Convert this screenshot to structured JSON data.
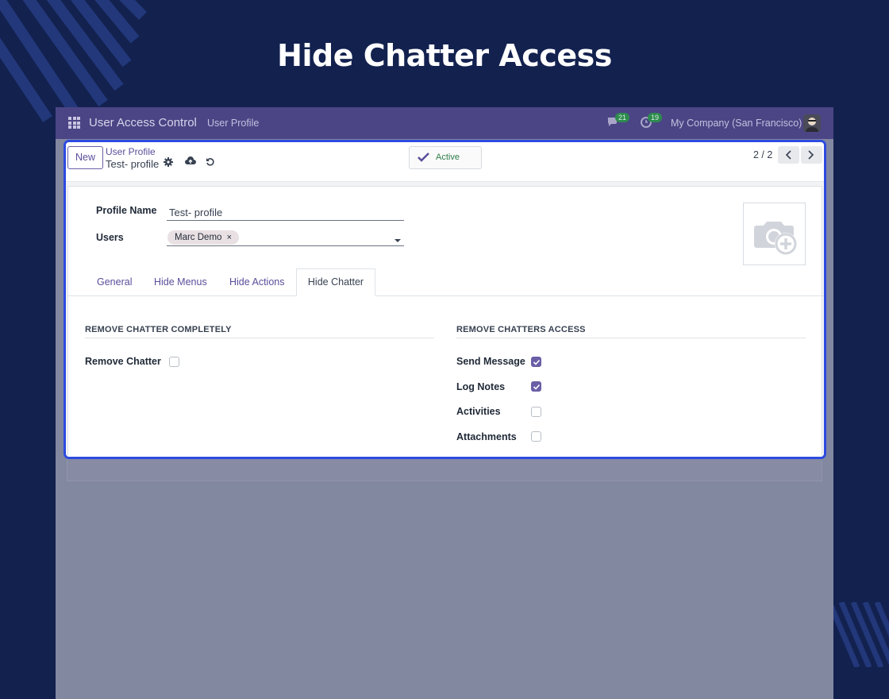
{
  "banner": {
    "title": "Hide Chatter Access"
  },
  "navbar": {
    "app_name": "User Access Control",
    "menu_item": "User Profile",
    "messages_count": "21",
    "activities_count": "19",
    "company": "My Company (San Francisco)"
  },
  "control_panel": {
    "new_label": "New",
    "breadcrumb_parent": "User Profile",
    "breadcrumb_current": "Test- profile",
    "status_label": "Active",
    "pager": "2 / 2"
  },
  "form": {
    "profile_name_label": "Profile Name",
    "profile_name_value": "Test- profile",
    "users_label": "Users",
    "users_tags": [
      "Marc Demo"
    ],
    "tag_remove": "×"
  },
  "tabs": [
    {
      "label": "General",
      "active": false
    },
    {
      "label": "Hide Menus",
      "active": false
    },
    {
      "label": "Hide Actions",
      "active": false
    },
    {
      "label": "Hide Chatter",
      "active": true
    }
  ],
  "left_section": {
    "title": "REMOVE CHATTER COMPLETELY",
    "fields": [
      {
        "label": "Remove Chatter",
        "checked": false
      }
    ]
  },
  "right_section": {
    "title": "REMOVE CHATTERS ACCESS",
    "fields": [
      {
        "label": "Send Message",
        "checked": true
      },
      {
        "label": "Log Notes",
        "checked": true
      },
      {
        "label": "Activities",
        "checked": false
      },
      {
        "label": "Attachments",
        "checked": false
      }
    ]
  },
  "colors": {
    "background": "#13214f",
    "navbar": "#4b4585",
    "accent": "#6a5fa6",
    "highlight_border": "#2d4be0",
    "active_status": "#2e7d4a"
  }
}
